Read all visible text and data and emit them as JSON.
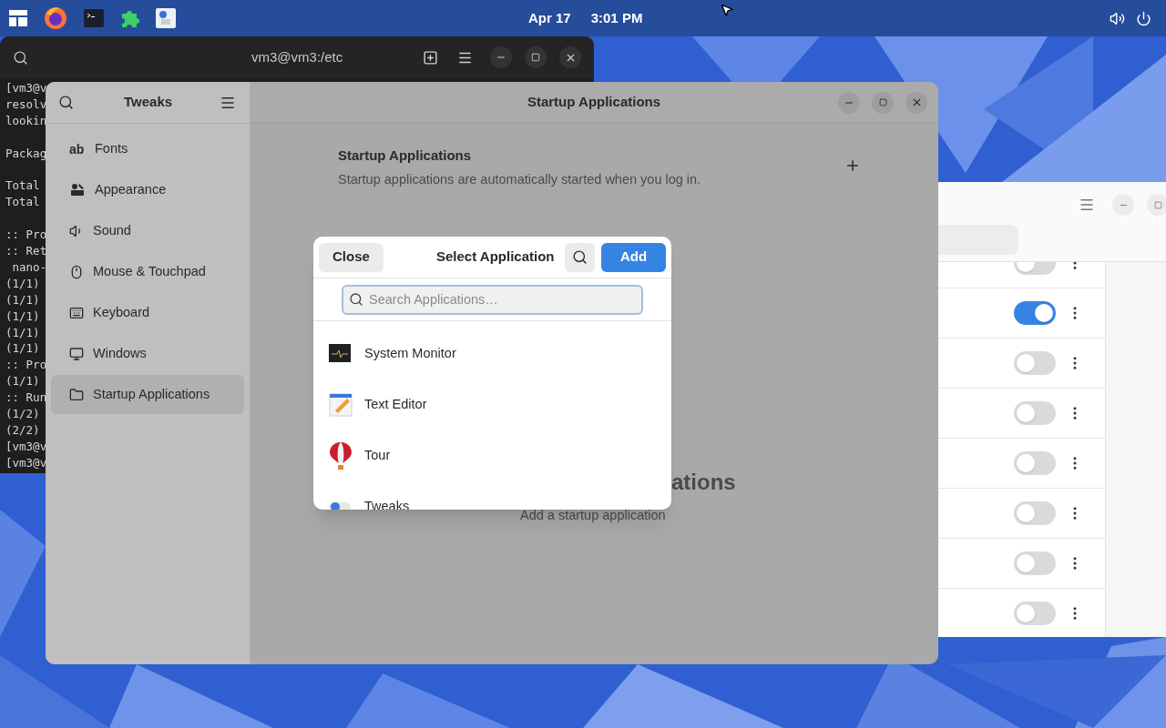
{
  "top_bar": {
    "date": "Apr 17",
    "time": "3:01 PM"
  },
  "terminal": {
    "title": "vm3@vm3:/etc",
    "blocks": [
      [
        "[vm3@v",
        "resolv",
        "lookin"
      ],
      [
        "Packag"
      ],
      [
        "Total",
        "Total"
      ],
      [
        ":: Pro",
        ":: Ret",
        " nano-",
        "(1/1)",
        "(1/1)",
        "(1/1)",
        "(1/1)",
        "(1/1)",
        ":: Pro",
        "(1/1)",
        ":: Run",
        "(1/2)",
        "(2/2)",
        "[vm3@v",
        "[vm3@v"
      ]
    ]
  },
  "right_window": {
    "toggles": [
      {
        "on": false
      },
      {
        "on": true
      },
      {
        "on": false
      },
      {
        "on": false
      },
      {
        "on": false
      },
      {
        "on": false
      },
      {
        "on": false
      },
      {
        "on": false
      }
    ]
  },
  "tweaks": {
    "title": "Tweaks",
    "header_title": "Startup Applications",
    "sidebar": [
      {
        "kind": "fonts",
        "glyph": "ab",
        "label": "Fonts",
        "selected": false
      },
      {
        "kind": "appearance",
        "label": "Appearance",
        "selected": false
      },
      {
        "kind": "sound",
        "label": "Sound",
        "selected": false
      },
      {
        "kind": "mouse",
        "label": "Mouse & Touchpad",
        "selected": false
      },
      {
        "kind": "keyboard",
        "label": "Keyboard",
        "selected": false
      },
      {
        "kind": "windows",
        "label": "Windows",
        "selected": false
      },
      {
        "kind": "startup",
        "label": "Startup Applications",
        "selected": true
      }
    ],
    "heading": "Startup Applications",
    "description": "Startup applications are automatically started when you log in.",
    "empty_title": "ations",
    "empty_hint": "Add a startup application"
  },
  "dialog": {
    "close": "Close",
    "title": "Select Application",
    "add": "Add",
    "search_placeholder": "Search Applications…",
    "apps": [
      {
        "kind": "system-monitor",
        "name": "System Monitor"
      },
      {
        "kind": "text-editor",
        "name": "Text Editor"
      },
      {
        "kind": "tour",
        "name": "Tour"
      },
      {
        "kind": "tweaks",
        "name": "Tweaks"
      }
    ]
  }
}
